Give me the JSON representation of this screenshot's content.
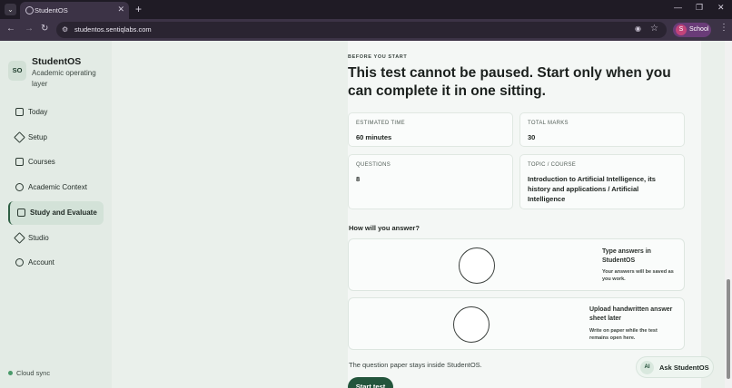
{
  "browser": {
    "tab_title": "StudentOS",
    "url": "studentos.sentiqlabs.com",
    "profile_initial": "S",
    "profile_label": "School"
  },
  "sidebar": {
    "brand_mark": "SO",
    "brand_name": "StudentOS",
    "brand_tagline": "Academic operating layer",
    "items": [
      {
        "label": "Today",
        "icon": "square-icon"
      },
      {
        "label": "Setup",
        "icon": "diamond-icon"
      },
      {
        "label": "Courses",
        "icon": "square-minus-icon"
      },
      {
        "label": "Academic Context",
        "icon": "circle-minus-icon"
      },
      {
        "label": "Study and Evaluate",
        "icon": "square-icon",
        "active": true
      },
      {
        "label": "Studio",
        "icon": "diamond-icon"
      },
      {
        "label": "Account",
        "icon": "circle-minus-icon"
      }
    ],
    "sync_label": "Cloud sync"
  },
  "main": {
    "eyebrow": "BEFORE YOU START",
    "headline": "This test cannot be paused. Start only when you can complete it in one sitting.",
    "estimated_time": {
      "label": "ESTIMATED TIME",
      "value": "60 minutes"
    },
    "total_marks": {
      "label": "TOTAL MARKS",
      "value": "30"
    },
    "questions": {
      "label": "QUESTIONS",
      "value": "8"
    },
    "topic": {
      "label": "TOPIC / COURSE",
      "value": "Introduction to Artificial Intelligence, its history and applications / Artificial Intelligence"
    },
    "answer_question": "How will you answer?",
    "options": [
      {
        "title": "Type answers in StudentOS",
        "description": "Your answers will be saved as you work."
      },
      {
        "title": "Upload handwritten answer sheet later",
        "description": "Write on paper while the test remains open here."
      }
    ],
    "footnote": "The question paper stays inside StudentOS.",
    "start_label": "Start test"
  },
  "assistant": {
    "badge": "AI",
    "label": "Ask StudentOS"
  }
}
